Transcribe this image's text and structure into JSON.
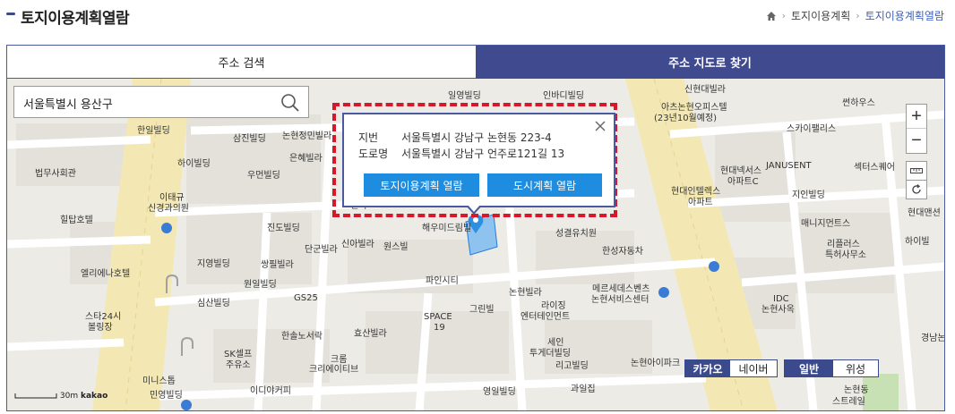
{
  "header": {
    "title": "토지이용계획열람",
    "breadcrumb": {
      "level1": "토지이용계획",
      "level2": "토지이용계획열람"
    }
  },
  "tabs": [
    {
      "label": "주소 검색",
      "active": false
    },
    {
      "label": "주소 지도로 찾기",
      "active": true
    }
  ],
  "search": {
    "value": "서울특별시 용산구",
    "placeholder": ""
  },
  "popup": {
    "jibun_key": "지번",
    "jibun_value": "서울특별시 강남구 논현동 223-4",
    "road_key": "도로명",
    "road_value": "서울특별시 강남구 언주로121길 13",
    "btn_land": "토지이용계획 열람",
    "btn_city": "도시계획 열람"
  },
  "map_type": {
    "kakao": "카카오",
    "naver": "네이버",
    "normal": "일반",
    "satellite": "위성"
  },
  "scale": {
    "distance": "30m",
    "provider": "kakao"
  },
  "map_labels": [
    "일영빌딩",
    "인바디빌딩",
    "신현대빌라",
    "아츠논현오피스텔",
    "(23년10월예정)",
    "썬하우스",
    "스카이팰리스",
    "한일빌딩",
    "삼진빌딩",
    "논현정민빌라",
    "하이빌딩",
    "은혜빌라",
    "우먼빌딩",
    "법무사회관",
    "이태규",
    "신경과의원",
    "힐탑호텔",
    "진도빌딩",
    "단군빌라",
    "신아빌라",
    "원스빌",
    "해우미드림빌",
    "성결유치원",
    "한성자동차",
    "현대넥서스",
    "아파트C",
    "JANUSENT",
    "섹터스퀘어",
    "지인빌딩",
    "현대인텔렉스",
    "아파트",
    "매니지먼트스",
    "리플러스",
    "특허사무소",
    "하이빌",
    "현대맨션",
    "엘리에나호텔",
    "지영빌딩",
    "쌍필빌라",
    "원일빌딩",
    "GS25",
    "파인시티",
    "논현빌라",
    "메르세데스벤츠",
    "논현서비스센터",
    "IDC",
    "논현사옥",
    "스타24시",
    "볼링장",
    "심산빌딩",
    "SPACE",
    "19",
    "그린빌",
    "라이징",
    "엔터테인먼트",
    "한솔노서락",
    "효산빌라",
    "크롬",
    "크리에이티브",
    "세인",
    "투게더빌딩",
    "리고빌딩",
    "SK셀프",
    "주유소",
    "미니스톱",
    "민영빌딩",
    "이디야커피",
    "영일빌딩",
    "과일집",
    "논현아이파크",
    "엔터",
    "경남논",
    "논현동",
    "스트레일"
  ]
}
